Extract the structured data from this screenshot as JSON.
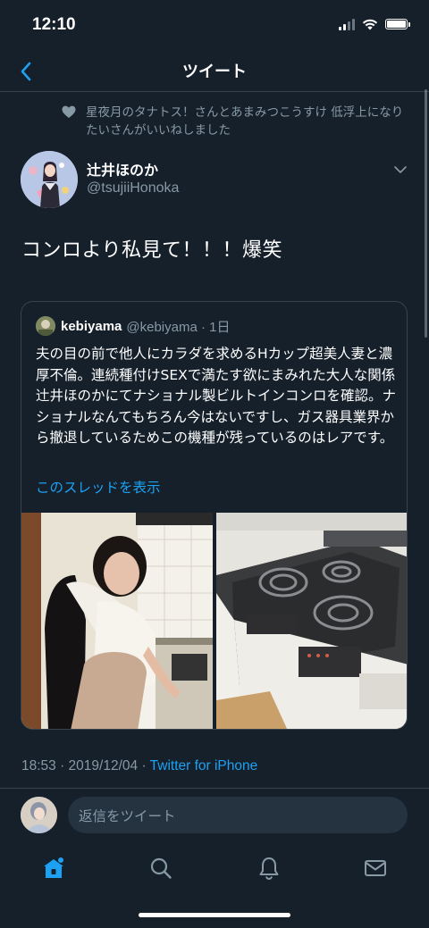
{
  "status_bar": {
    "time": "12:10"
  },
  "nav": {
    "title": "ツイート"
  },
  "liked_by": {
    "text": "星夜月のタナトス！さんとあまみつこうすけ 低浮上になりたいさんがいいねしました"
  },
  "tweet": {
    "author_name": "辻井ほのか",
    "author_handle": "@tsujiiHonoka",
    "text": "コンロより私見て！！！爆笑",
    "timestamp": "18:53 · 2019/12/04 · ",
    "source": "Twitter for iPhone"
  },
  "quoted": {
    "name": "kebiyama",
    "handle_date": "@kebiyama · 1日",
    "text": "夫の目の前で他人にカラダを求めるHカップ超美人妻と濃厚不倫。連続種付けSEXで満たす欲にまみれた大人な関係 辻井ほのかにてナショナル製ビルトインコンロを確認。ナショナルなんてもちろん今はないですし、ガス器具業界から撤退しているためこの機種が残っているのはレアです。",
    "show_thread": "このスレッドを表示"
  },
  "reply": {
    "placeholder": "返信をツイート"
  },
  "colors": {
    "background": "#15202b",
    "accent": "#1da1f2",
    "secondary_text": "#8899a6",
    "border": "#38444d"
  },
  "icons": [
    "back-chevron-icon",
    "heart-icon",
    "chevron-down-icon",
    "home-icon",
    "search-icon",
    "bell-icon",
    "mail-icon"
  ]
}
